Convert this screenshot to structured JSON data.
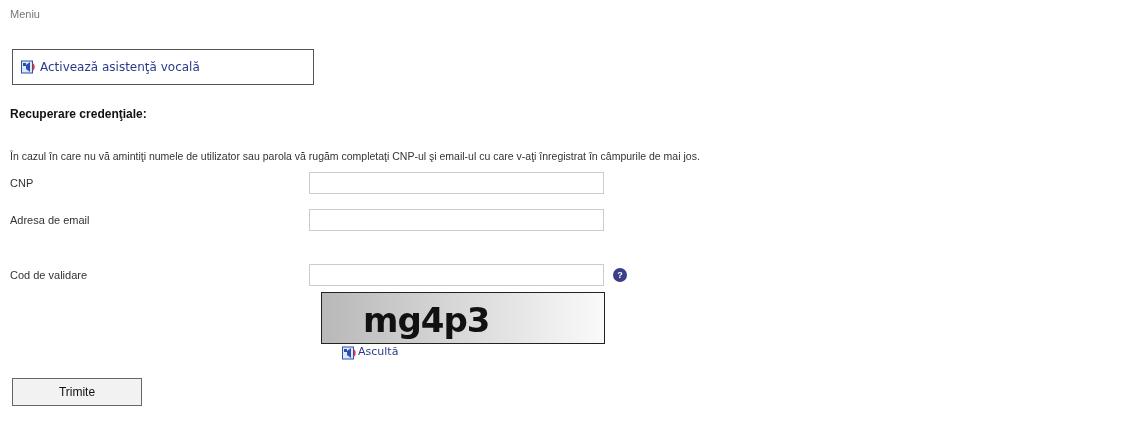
{
  "menu_link": "Meniu",
  "voice_button": "Activează asistenţă vocală",
  "heading": "Recuperare credenţiale:",
  "instructions": "În cazul în care nu vă amintiţi numele de utilizator sau parola vă rugăm completaţi CNP-ul şi email-ul cu care v-aţi înregistrat în câmpurile de mai jos.",
  "fields": [
    {
      "label": "CNP"
    },
    {
      "label": "Adresa de email"
    },
    {
      "label": "Cod de validare",
      "help": "?"
    }
  ],
  "captcha": {
    "text": "mg4p3",
    "listen_link": "Ascultă"
  },
  "submit_button": "Trimite"
}
